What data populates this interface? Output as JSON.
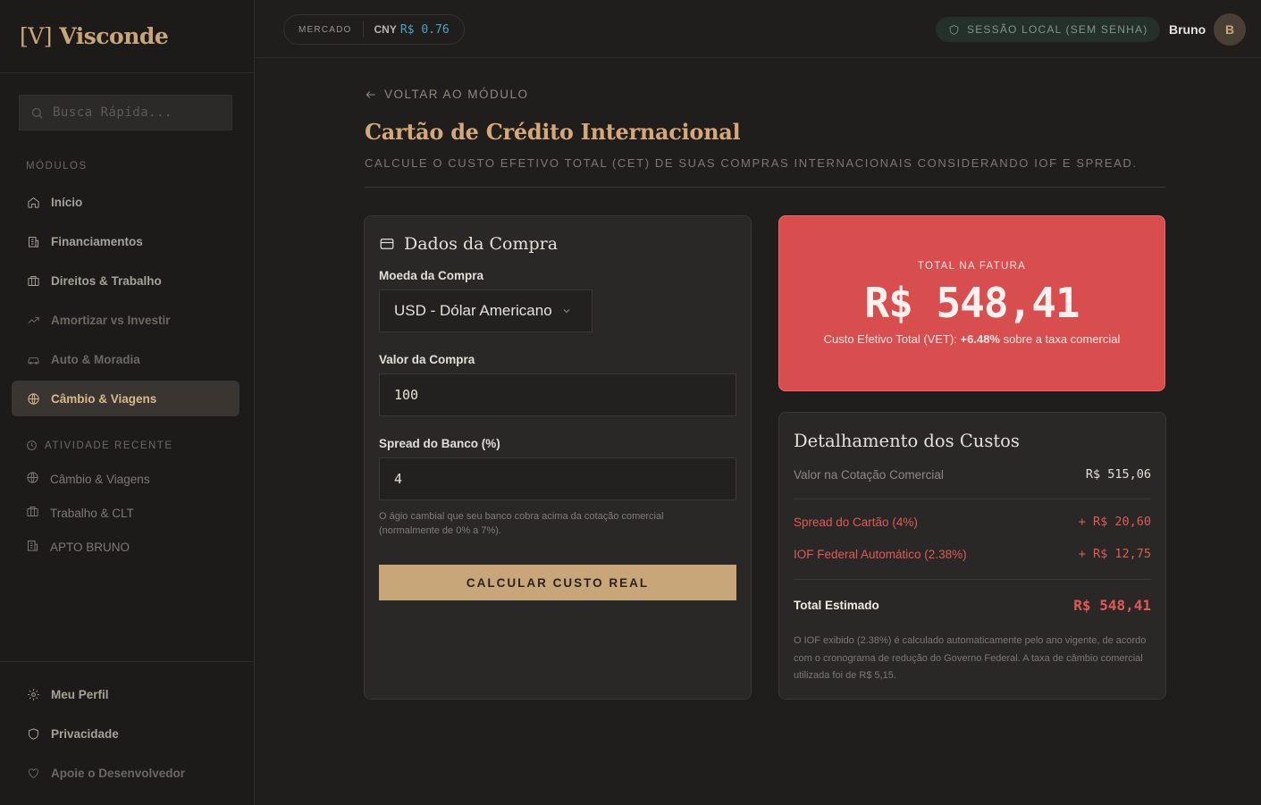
{
  "app": {
    "logo_bracket": "[V]",
    "logo_name": "Visconde"
  },
  "sidebar": {
    "search_placeholder": "Busca Rápida...",
    "modules_label": "MÓDULOS",
    "items": [
      {
        "label": "Início",
        "icon": "home-icon"
      },
      {
        "label": "Financiamentos",
        "icon": "building-icon"
      },
      {
        "label": "Direitos & Trabalho",
        "icon": "briefcase-icon"
      },
      {
        "label": "Amortizar vs Investir",
        "icon": "trend-icon"
      },
      {
        "label": "Auto & Moradia",
        "icon": "car-icon"
      },
      {
        "label": "Câmbio & Viagens",
        "icon": "globe-icon"
      }
    ],
    "recent_label": "ATIVIDADE RECENTE",
    "recent": [
      {
        "label": "Câmbio & Viagens",
        "icon": "globe-icon"
      },
      {
        "label": "Trabalho & CLT",
        "icon": "briefcase-icon"
      },
      {
        "label": "APTO BRUNO",
        "icon": "building-icon"
      }
    ],
    "footer": [
      {
        "label": "Meu Perfil",
        "icon": "gear-icon"
      },
      {
        "label": "Privacidade",
        "icon": "shield-icon"
      },
      {
        "label": "Apoie o Desenvolvedor",
        "icon": "heart-icon"
      }
    ]
  },
  "topbar": {
    "market_label": "MERCADO",
    "currency": "CNY",
    "rate": "R$ 0.76",
    "session": "SESSÃO LOCAL (SEM SENHA)",
    "user": "Bruno",
    "avatar": "B"
  },
  "main": {
    "back": "VOLTAR AO MÓDULO",
    "title": "Cartão de Crédito Internacional",
    "subtitle": "CALCULE O CUSTO EFETIVO TOTAL (CET) DE SUAS COMPRAS INTERNACIONAIS CONSIDERANDO IOF E SPREAD."
  },
  "form": {
    "title": "Dados da Compra",
    "currency_label": "Moeda da Compra",
    "currency_value": "USD - Dólar Americano",
    "value_label": "Valor da Compra",
    "value": "100",
    "spread_label": "Spread do Banco (%)",
    "spread": "4",
    "spread_help": "O ágio cambial que seu banco cobra acima da cotação comercial (normalmente de 0% a 7%).",
    "button": "CALCULAR CUSTO REAL"
  },
  "total": {
    "label": "TOTAL NA FATURA",
    "value": "R$ 548,41",
    "sub_prefix": "Custo Efetivo Total (VET): ",
    "sub_pct": "+6.48%",
    "sub_suffix": " sobre a taxa comercial"
  },
  "detail": {
    "title": "Detalhamento dos Custos",
    "commercial_label": "Valor na Cotação Comercial",
    "commercial_value": "R$ 515,06",
    "spread_label": "Spread do Cartão (4%)",
    "spread_value": "+ R$ 20,60",
    "iof_label": "IOF Federal Automático (2.38%)",
    "iof_value": "+ R$ 12,75",
    "total_label": "Total Estimado",
    "total_value": "R$ 548,41",
    "note": "O IOF exibido (2.38%) é calculado automaticamente pelo ano vigente, de acordo com o cronograma de redução do Governo Federal. A taxa de câmbio comercial utilizada foi de R$ 5,15."
  },
  "colors": {
    "accent": "#c9a57a",
    "danger": "#d84e4e",
    "bg": "#1f1e1d"
  }
}
